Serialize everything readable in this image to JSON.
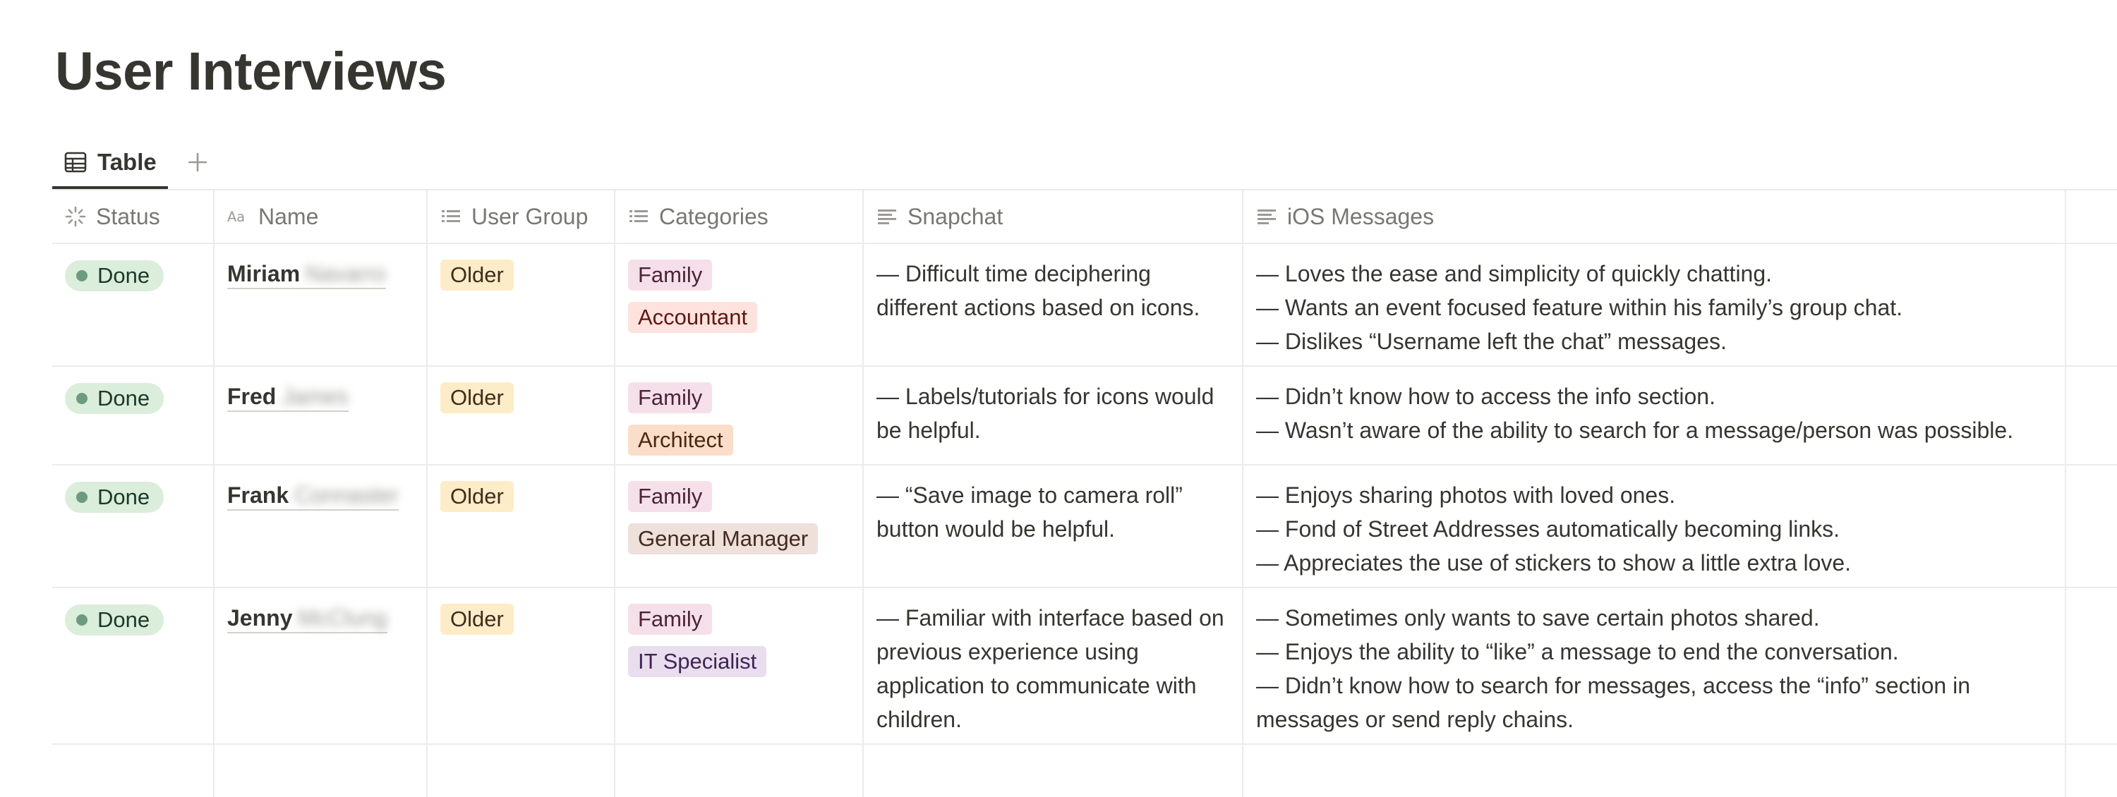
{
  "page": {
    "title": "User Interviews"
  },
  "views": {
    "active_tab": "Table",
    "table_icon": "table-icon",
    "add_icon": "plus-icon"
  },
  "columns": [
    {
      "label": "Status",
      "icon": "status-spinner-icon"
    },
    {
      "label": "Name",
      "icon": "text-aa-icon"
    },
    {
      "label": "User Group",
      "icon": "list-icon"
    },
    {
      "label": "Categories",
      "icon": "list-icon"
    },
    {
      "label": "Snapchat",
      "icon": "text-lines-icon"
    },
    {
      "label": "iOS Messages",
      "icon": "text-lines-icon"
    }
  ],
  "rows": [
    {
      "status": "Done",
      "first_name": "Miriam",
      "surname": "Navarro",
      "user_group": "Older",
      "categories": [
        "Family",
        "Accountant"
      ],
      "snapchat": [
        "— Difficult time deciphering different actions based on icons."
      ],
      "ios": [
        "— Loves the ease and simplicity of quickly chatting.",
        "— Wants an event focused feature within his family’s group chat.",
        "— Dislikes “Username left the chat” messages."
      ]
    },
    {
      "status": "Done",
      "first_name": "Fred",
      "surname": "James",
      "user_group": "Older",
      "categories": [
        "Family",
        "Architect"
      ],
      "snapchat": [
        "— Labels/tutorials for icons would be helpful."
      ],
      "ios": [
        "— Didn’t know how to access the info section.",
        "— Wasn’t aware of the ability to search for a message/person was possible."
      ]
    },
    {
      "status": "Done",
      "first_name": "Frank",
      "surname": "Connaster",
      "user_group": "Older",
      "categories": [
        "Family",
        "General Manager"
      ],
      "snapchat": [
        "— “Save image to camera roll” button would be helpful."
      ],
      "ios": [
        "— Enjoys sharing photos with loved ones.",
        "— Fond of Street Addresses automatically becoming links.",
        "— Appreciates the use of stickers to show a little extra love."
      ]
    },
    {
      "status": "Done",
      "first_name": "Jenny",
      "surname": "McClung",
      "user_group": "Older",
      "categories": [
        "Family",
        "IT Specialist"
      ],
      "snapchat": [
        "— Familiar with interface based on previous experience using application to communicate with children."
      ],
      "ios": [
        "— Sometimes only wants to save certain photos shared.",
        "— Enjoys the ability to “like” a message to end the conversation.",
        "— Didn’t know how to search for messages, access the “info” section in messages or send reply chains."
      ]
    }
  ],
  "colors": {
    "status_done_bg": "#dbeddb",
    "status_done_dot": "#6c9b7d",
    "tag_older": "#fdecc8",
    "tag_family": "#f5e0e9",
    "tag_accountant": "#ffe2dd",
    "tag_architect": "#fadec9",
    "tag_general_manager": "#eee0da",
    "tag_it_specialist": "#e8deee"
  }
}
